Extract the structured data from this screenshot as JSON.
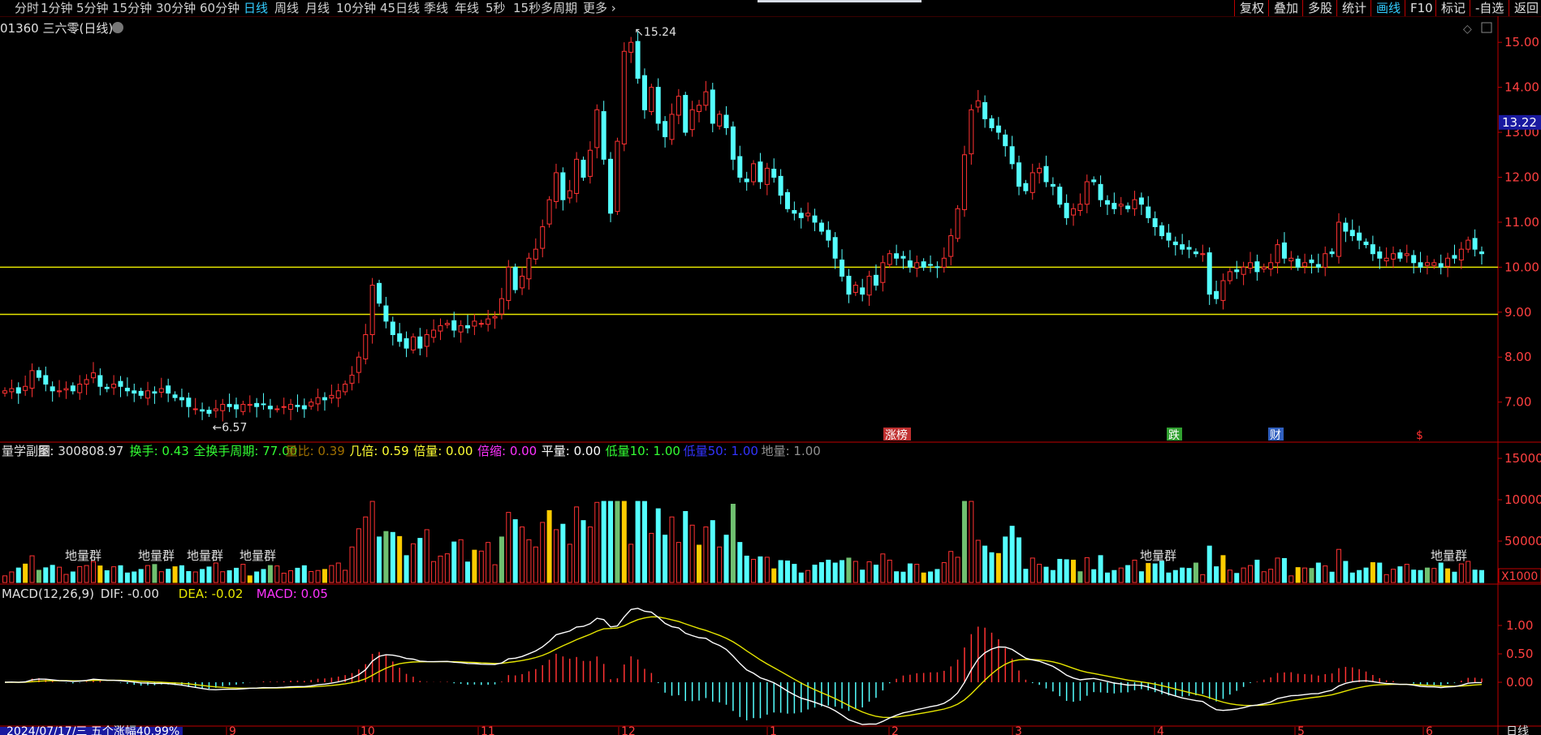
{
  "toolbar": {
    "periods": [
      "分时",
      "1分钟",
      "5分钟",
      "15分钟",
      "30分钟",
      "60分钟",
      "日线",
      "周线",
      "月线",
      "10分钟",
      "45日线",
      "季线",
      "年线",
      "5秒",
      "15秒",
      "多周期",
      "更多"
    ],
    "active_period": "日线",
    "right_tools": [
      "复权",
      "叠加",
      "多股",
      "统计",
      "画线",
      "F10",
      "标记",
      "-自选",
      "返回"
    ],
    "active_tool": "画线"
  },
  "stock": {
    "code_title": "01360 三六零(日线)"
  },
  "colors": {
    "up": "#ff3232",
    "down": "#54ffff",
    "axis": "#c00000",
    "hline": "#e6e600",
    "dif": "#ffffff",
    "dea": "#e6e600",
    "macd_pos": "#ff3232",
    "macd_neg": "#54ffff"
  },
  "main_chart": {
    "price_axis": [
      "15.00",
      "14.00",
      "13.00",
      "12.00",
      "11.00",
      "10.00",
      "9.00",
      "8.00",
      "7.00"
    ],
    "current_price_tag": "13.22",
    "high_label": "15.24",
    "low_label": "6.57",
    "support_lines": [
      10.0,
      8.95
    ],
    "markers": [
      "涨榜",
      "跌",
      "财",
      "$"
    ]
  },
  "volume_panel": {
    "legend": [
      {
        "text": "量学副图",
        "color": "#e0e0e0"
      },
      {
        "text": "量: 300808.97",
        "color": "#e0e0e0"
      },
      {
        "text": "换手: 0.43",
        "color": "#33ff33"
      },
      {
        "text": "全换手周期: 77.00",
        "color": "#33ff33"
      },
      {
        "text": "量比: 0.39",
        "color": "#a07000"
      },
      {
        "text": "几倍: 0.59",
        "color": "#ffff33"
      },
      {
        "text": "倍量: 0.00",
        "color": "#ffff33"
      },
      {
        "text": "倍缩: 0.00",
        "color": "#ff33ff"
      },
      {
        "text": "平量: 0.00",
        "color": "#ffffff"
      },
      {
        "text": "低量10: 1.00",
        "color": "#33ff33"
      },
      {
        "text": "低量50: 1.00",
        "color": "#3333ff"
      },
      {
        "text": "地量: 1.00",
        "color": "#909090"
      }
    ],
    "axis": [
      "150000",
      "100000",
      "50000"
    ],
    "unit_tag": "X1000",
    "ground_labels": [
      "地量群",
      "地量群",
      "地量群",
      "地量群",
      "地量群",
      "地量群"
    ]
  },
  "macd_panel": {
    "legend": [
      {
        "text": "MACD(12,26,9)",
        "color": "#e0e0e0"
      },
      {
        "text": "DIF: -0.00",
        "color": "#e0e0e0"
      },
      {
        "text": "DEA: -0.02",
        "color": "#e6e600"
      },
      {
        "text": "MACD: 0.05",
        "color": "#ff33ff"
      }
    ],
    "axis": [
      "1.00",
      "0.50",
      "0.00"
    ]
  },
  "date_axis": {
    "info": "2024/07/17/三 五个涨幅40.99%",
    "months": [
      "9",
      "10",
      "11",
      "12",
      "1",
      "2",
      "3",
      "4",
      "5",
      "6"
    ],
    "tab": "日线"
  },
  "chart_data": {
    "type": "candlestick",
    "title": "01360 三六零(日线)",
    "ylim": [
      6.2,
      15.4
    ],
    "support_lines": [
      10.0,
      8.95
    ],
    "high": 15.24,
    "low": 6.57,
    "closes": [
      7.25,
      7.3,
      7.2,
      7.35,
      7.7,
      7.55,
      7.4,
      7.25,
      7.25,
      7.3,
      7.25,
      7.4,
      7.5,
      7.65,
      7.35,
      7.3,
      7.4,
      7.35,
      7.25,
      7.2,
      7.15,
      7.25,
      7.2,
      7.3,
      7.2,
      7.1,
      7.05,
      6.9,
      6.85,
      6.8,
      6.75,
      6.85,
      6.95,
      6.9,
      6.85,
      6.95,
      6.95,
      6.9,
      6.95,
      6.85,
      6.85,
      6.9,
      6.95,
      6.9,
      6.85,
      7.0,
      7.1,
      7.05,
      7.15,
      7.25,
      7.4,
      7.6,
      8.0,
      8.5,
      9.6,
      9.2,
      8.8,
      8.5,
      8.35,
      8.2,
      8.45,
      8.2,
      8.5,
      8.6,
      8.7,
      8.75,
      8.6,
      8.7,
      8.65,
      8.8,
      8.75,
      8.85,
      8.9,
      9.3,
      10.0,
      9.5,
      9.8,
      10.2,
      10.4,
      10.9,
      11.5,
      12.1,
      11.5,
      11.7,
      12.4,
      12.0,
      12.6,
      13.5,
      12.4,
      11.2,
      12.8,
      14.8,
      15.0,
      14.2,
      13.5,
      14.0,
      13.2,
      12.9,
      13.4,
      13.8,
      13.0,
      13.5,
      13.6,
      13.9,
      13.2,
      13.4,
      13.1,
      12.4,
      12.0,
      11.9,
      12.3,
      11.9,
      12.2,
      12.0,
      11.6,
      11.3,
      11.2,
      11.1,
      11.2,
      11.0,
      10.8,
      10.6,
      10.2,
      9.8,
      9.4,
      9.6,
      9.4,
      9.8,
      9.6,
      10.1,
      10.3,
      10.2,
      10.2,
      10.0,
      10.1,
      10.0,
      10.05,
      10.0,
      10.2,
      10.7,
      11.3,
      12.5,
      13.5,
      13.7,
      13.3,
      13.1,
      13.0,
      12.7,
      12.3,
      11.8,
      11.7,
      12.1,
      12.2,
      11.9,
      11.8,
      11.4,
      11.1,
      11.3,
      11.4,
      11.9,
      11.9,
      11.5,
      11.4,
      11.3,
      11.4,
      11.3,
      11.5,
      11.4,
      11.1,
      10.9,
      10.7,
      10.6,
      10.5,
      10.4,
      10.4,
      10.3,
      10.3,
      9.4,
      9.3,
      9.7,
      9.9,
      9.9,
      10.0,
      10.1,
      9.9,
      10.0,
      10.1,
      10.5,
      10.2,
      10.2,
      10.0,
      10.1,
      10.1,
      10.0,
      10.3,
      10.3,
      11.0,
      10.8,
      10.7,
      10.6,
      10.5,
      10.3,
      10.2,
      10.2,
      10.3,
      10.2,
      10.3,
      10.1,
      10.0,
      10.1,
      10.1,
      10.0,
      10.2,
      10.2,
      10.4,
      10.6,
      10.4,
      10.3
    ]
  }
}
